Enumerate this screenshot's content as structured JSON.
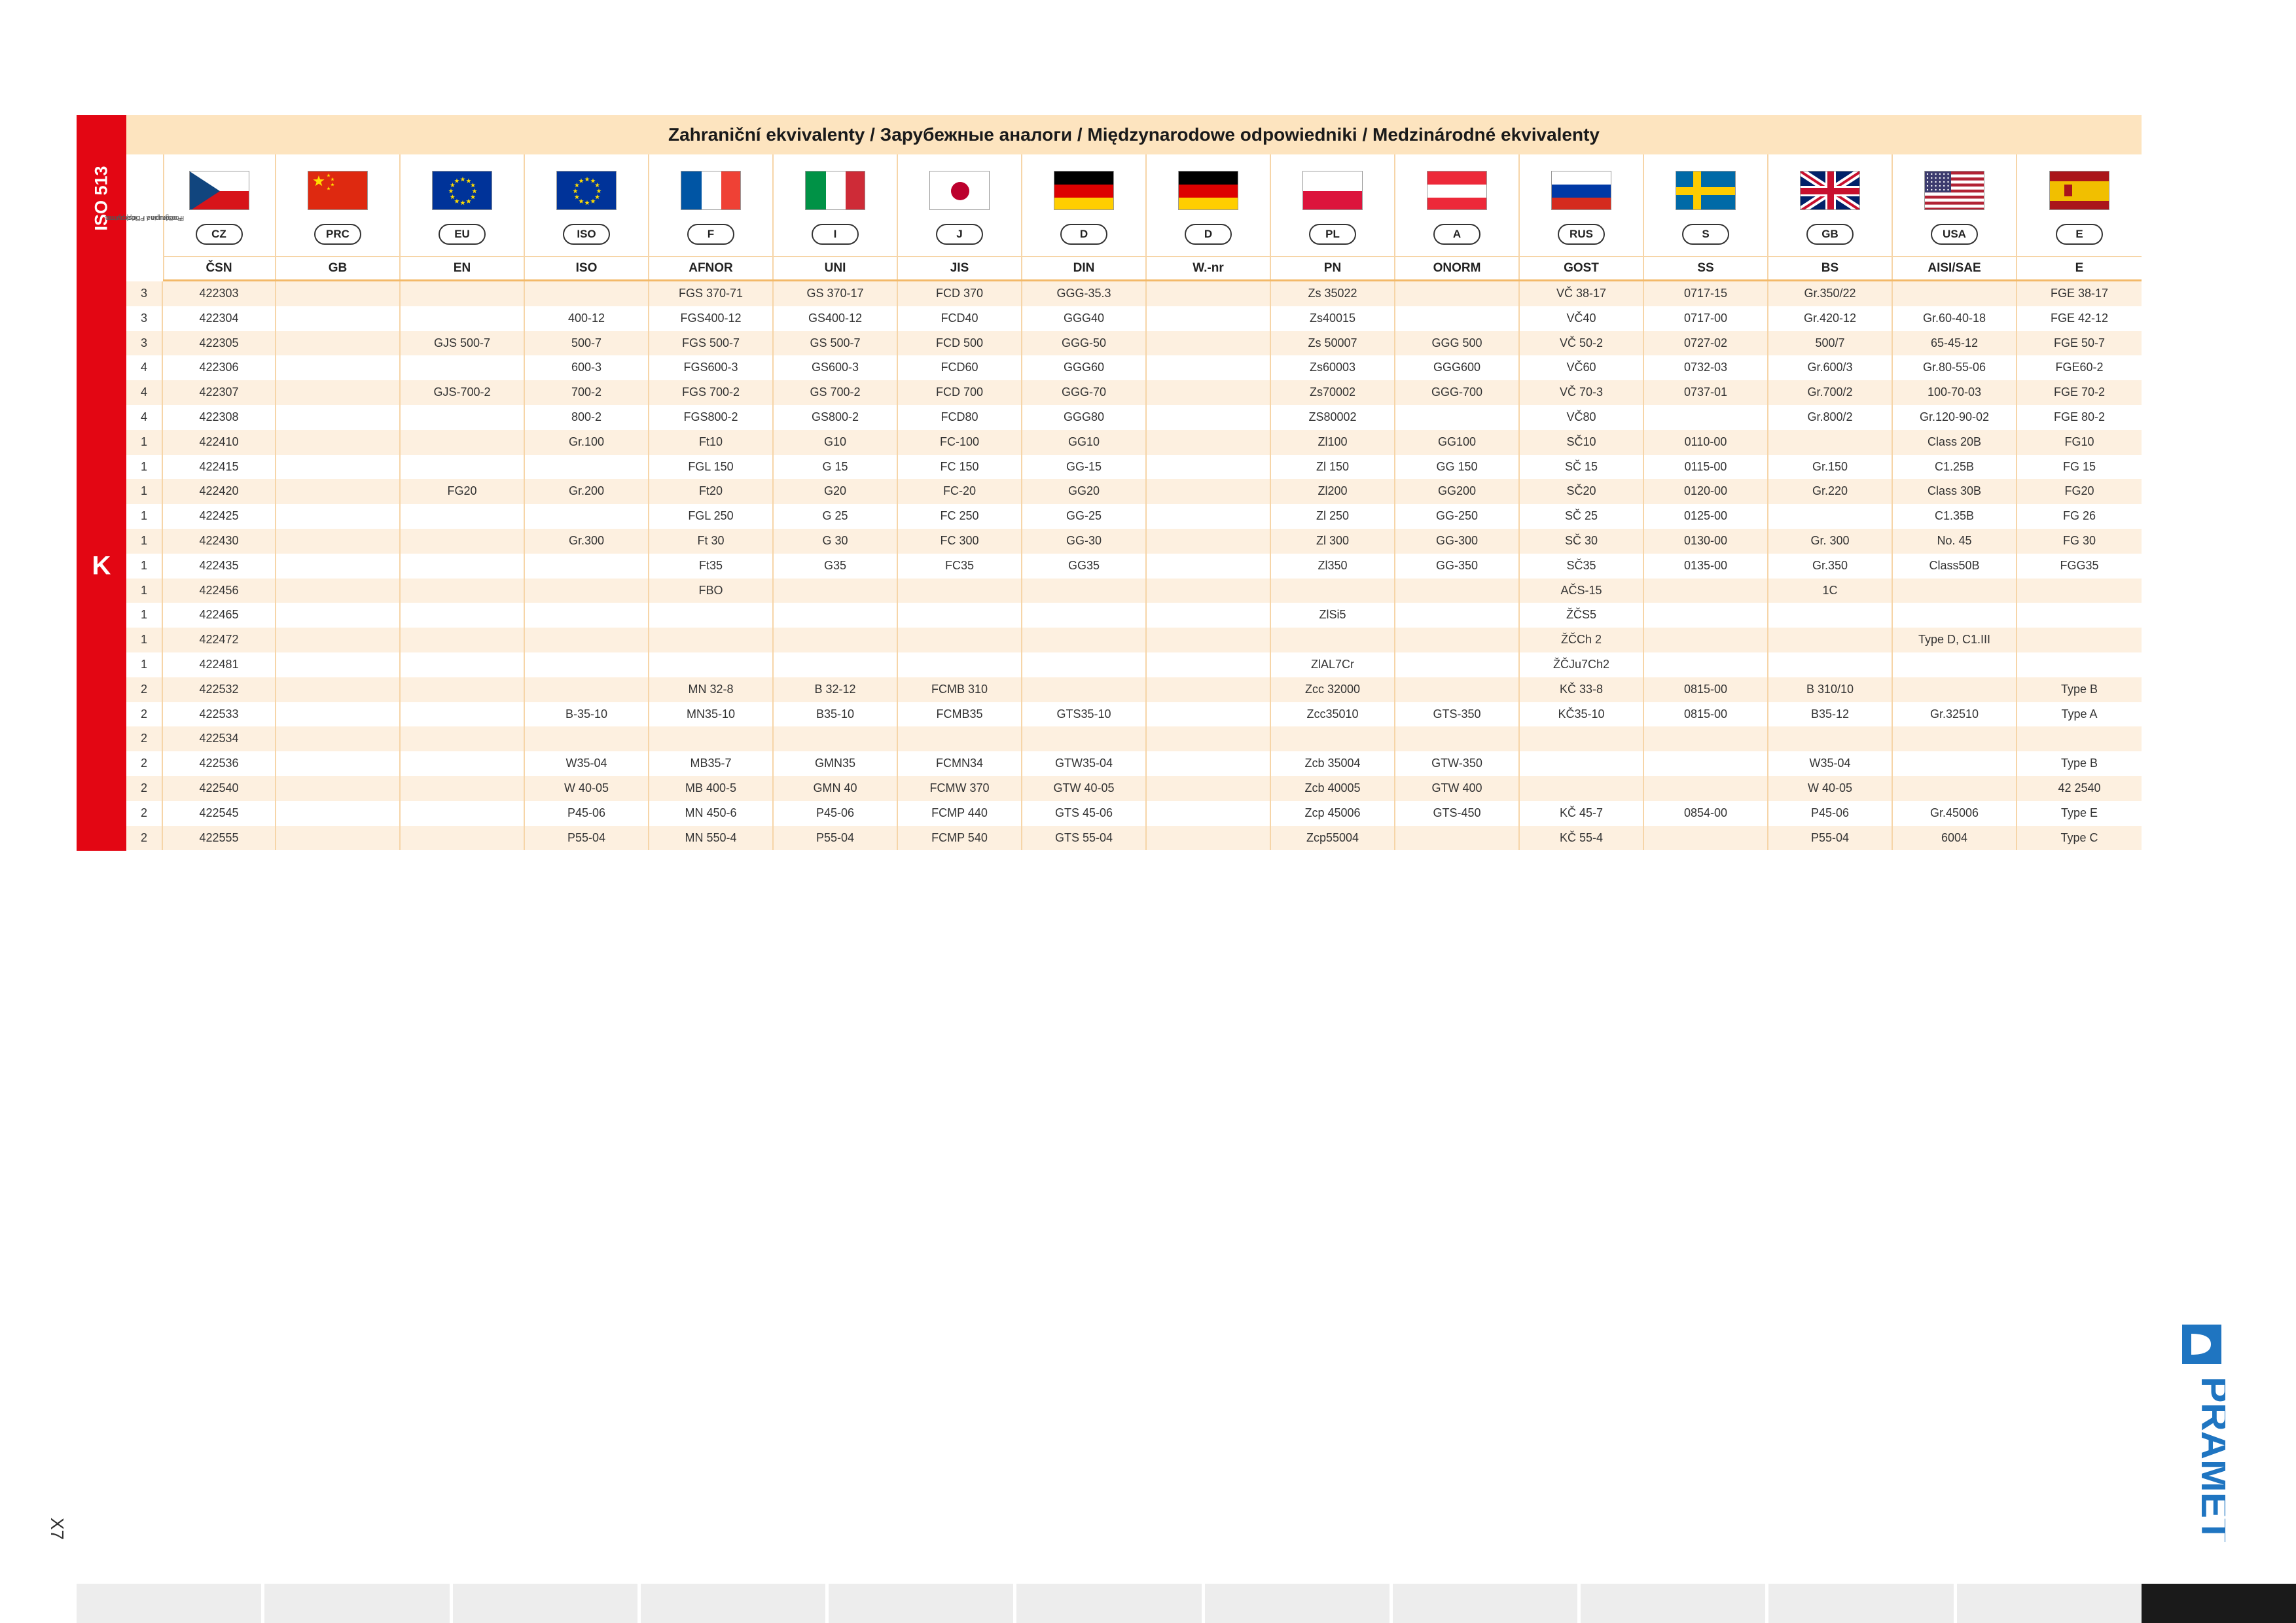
{
  "header": {
    "title": "Zahraniční ekvivalenty / Зарубежные аналоги / Międzynarodowe odpowiedniki / Medzinárodné ekvivalenty",
    "iso_label": "ISO 513",
    "group_label": "K",
    "subgroup_label_1": "Podskupina / Подгруппа",
    "subgroup_label_2": "Podgrupa / Podskupina"
  },
  "countries": [
    {
      "code": "CZ",
      "flag": "cz-flag",
      "std": "ČSN"
    },
    {
      "code": "PRC",
      "flag": "cn-flag",
      "std": "GB"
    },
    {
      "code": "EU",
      "flag": "eu-flag",
      "std": "EN"
    },
    {
      "code": "ISO",
      "flag": "eu-flag",
      "std": "ISO"
    },
    {
      "code": "F",
      "flag": "fr-flag",
      "std": "AFNOR"
    },
    {
      "code": "I",
      "flag": "it-flag",
      "std": "UNI"
    },
    {
      "code": "J",
      "flag": "jp-flag",
      "std": "JIS"
    },
    {
      "code": "D",
      "flag": "de-flag",
      "std": "DIN"
    },
    {
      "code": "D",
      "flag": "de-flag",
      "std": "W.-nr"
    },
    {
      "code": "PL",
      "flag": "pl-flag",
      "std": "PN"
    },
    {
      "code": "A",
      "flag": "at-flag",
      "std": "ONORM"
    },
    {
      "code": "RUS",
      "flag": "ru-flag",
      "std": "GOST"
    },
    {
      "code": "S",
      "flag": "se-flag",
      "std": "SS"
    },
    {
      "code": "GB",
      "flag": "gb-flag",
      "std": "BS"
    },
    {
      "code": "USA",
      "flag": "us-flag",
      "std": "AISI/SAE"
    },
    {
      "code": "E",
      "flag": "es-flag",
      "std": "E"
    }
  ],
  "rows": [
    [
      "3",
      "422303",
      "",
      "",
      "",
      "FGS 370-71",
      "GS 370-17",
      "FCD 370",
      "GGG-35.3",
      "",
      "Zs 35022",
      "",
      "VČ 38-17",
      "0717-15",
      "Gr.350/22",
      "",
      "FGE 38-17"
    ],
    [
      "3",
      "422304",
      "",
      "",
      "400-12",
      "FGS400-12",
      "GS400-12",
      "FCD40",
      "GGG40",
      "",
      "Zs40015",
      "",
      "VČ40",
      "0717-00",
      "Gr.420-12",
      "Gr.60-40-18",
      "FGE 42-12"
    ],
    [
      "3",
      "422305",
      "",
      "GJS 500-7",
      "500-7",
      "FGS 500-7",
      "GS 500-7",
      "FCD 500",
      "GGG-50",
      "",
      "Zs 50007",
      "GGG 500",
      "VČ 50-2",
      "0727-02",
      "500/7",
      "65-45-12",
      "FGE 50-7"
    ],
    [
      "4",
      "422306",
      "",
      "",
      "600-3",
      "FGS600-3",
      "GS600-3",
      "FCD60",
      "GGG60",
      "",
      "Zs60003",
      "GGG600",
      "VČ60",
      "0732-03",
      "Gr.600/3",
      "Gr.80-55-06",
      "FGE60-2"
    ],
    [
      "4",
      "422307",
      "",
      "GJS-700-2",
      "700-2",
      "FGS 700-2",
      "GS 700-2",
      "FCD 700",
      "GGG-70",
      "",
      "Zs70002",
      "GGG-700",
      "VČ 70-3",
      "0737-01",
      "Gr.700/2",
      "100-70-03",
      "FGE 70-2"
    ],
    [
      "4",
      "422308",
      "",
      "",
      "800-2",
      "FGS800-2",
      "GS800-2",
      "FCD80",
      "GGG80",
      "",
      "ZS80002",
      "",
      "VČ80",
      "",
      "Gr.800/2",
      "Gr.120-90-02",
      "FGE 80-2"
    ],
    [
      "1",
      "422410",
      "",
      "",
      "Gr.100",
      "Ft10",
      "G10",
      "FC-100",
      "GG10",
      "",
      "Zl100",
      "GG100",
      "SČ10",
      "0110-00",
      "",
      "Class 20B",
      "FG10"
    ],
    [
      "1",
      "422415",
      "",
      "",
      "",
      "FGL 150",
      "G 15",
      "FC 150",
      "GG-15",
      "",
      "Zl 150",
      "GG 150",
      "SČ 15",
      "0115-00",
      "Gr.150",
      "C1.25B",
      "FG 15"
    ],
    [
      "1",
      "422420",
      "",
      "FG20",
      "Gr.200",
      "Ft20",
      "G20",
      "FC-20",
      "GG20",
      "",
      "Zl200",
      "GG200",
      "SČ20",
      "0120-00",
      "Gr.220",
      "Class 30B",
      "FG20"
    ],
    [
      "1",
      "422425",
      "",
      "",
      "",
      "FGL 250",
      "G 25",
      "FC 250",
      "GG-25",
      "",
      "Zl 250",
      "GG-250",
      "SČ 25",
      "0125-00",
      "",
      "C1.35B",
      "FG 26"
    ],
    [
      "1",
      "422430",
      "",
      "",
      "Gr.300",
      "Ft 30",
      "G 30",
      "FC 300",
      "GG-30",
      "",
      "Zl 300",
      "GG-300",
      "SČ 30",
      "0130-00",
      "Gr. 300",
      "No. 45",
      "FG 30"
    ],
    [
      "1",
      "422435",
      "",
      "",
      "",
      "Ft35",
      "G35",
      "FC35",
      "GG35",
      "",
      "Zl350",
      "GG-350",
      "SČ35",
      "0135-00",
      "Gr.350",
      "Class50B",
      "FGG35"
    ],
    [
      "1",
      "422456",
      "",
      "",
      "",
      "FBO",
      "",
      "",
      "",
      "",
      "",
      "",
      "AČS-15",
      "",
      "1C",
      "",
      ""
    ],
    [
      "1",
      "422465",
      "",
      "",
      "",
      "",
      "",
      "",
      "",
      "",
      "ZlSi5",
      "",
      "ŽČS5",
      "",
      "",
      "",
      ""
    ],
    [
      "1",
      "422472",
      "",
      "",
      "",
      "",
      "",
      "",
      "",
      "",
      "",
      "",
      "ŽČCh 2",
      "",
      "",
      "Type D, C1.III",
      ""
    ],
    [
      "1",
      "422481",
      "",
      "",
      "",
      "",
      "",
      "",
      "",
      "",
      "ZlAL7Cr",
      "",
      "ŽČJu7Ch2",
      "",
      "",
      "",
      ""
    ],
    [
      "2",
      "422532",
      "",
      "",
      "",
      "MN 32-8",
      "B 32-12",
      "FCMB 310",
      "",
      "",
      "Zcc 32000",
      "",
      "KČ 33-8",
      "0815-00",
      "B 310/10",
      "",
      "Type B"
    ],
    [
      "2",
      "422533",
      "",
      "",
      "B-35-10",
      "MN35-10",
      "B35-10",
      "FCMB35",
      "GTS35-10",
      "",
      "Zcc35010",
      "GTS-350",
      "KČ35-10",
      "0815-00",
      "B35-12",
      "Gr.32510",
      "Type A"
    ],
    [
      "2",
      "422534",
      "",
      "",
      "",
      "",
      "",
      "",
      "",
      "",
      "",
      "",
      "",
      "",
      "",
      "",
      ""
    ],
    [
      "2",
      "422536",
      "",
      "",
      "W35-04",
      "MB35-7",
      "GMN35",
      "FCMN34",
      "GTW35-04",
      "",
      "Zcb 35004",
      "GTW-350",
      "",
      "",
      "W35-04",
      "",
      "Type B"
    ],
    [
      "2",
      "422540",
      "",
      "",
      "W 40-05",
      "MB 400-5",
      "GMN 40",
      "FCMW 370",
      "GTW 40-05",
      "",
      "Zcb 40005",
      "GTW 400",
      "",
      "",
      "W 40-05",
      "",
      "42 2540"
    ],
    [
      "2",
      "422545",
      "",
      "",
      "P45-06",
      "MN 450-6",
      "P45-06",
      "FCMP 440",
      "GTS 45-06",
      "",
      "Zcp 45006",
      "GTS-450",
      "KČ 45-7",
      "0854-00",
      "P45-06",
      "Gr.45006",
      "Type E"
    ],
    [
      "2",
      "422555",
      "",
      "",
      "P55-04",
      "MN 550-4",
      "P55-04",
      "FCMP 540",
      "GTS 55-04",
      "",
      "Zcp55004",
      "",
      "KČ 55-4",
      "",
      "P55-04",
      "6004",
      "Type C"
    ]
  ],
  "footer": {
    "page_number": "X7",
    "logo_text": "PRAMET",
    "logo_icon": "pramet-logo-icon"
  },
  "colors": {
    "red": "#e30613",
    "header_bg": "#fde4bf",
    "odd_row": "#fdf0e0",
    "logo_blue": "#1f75c1"
  }
}
